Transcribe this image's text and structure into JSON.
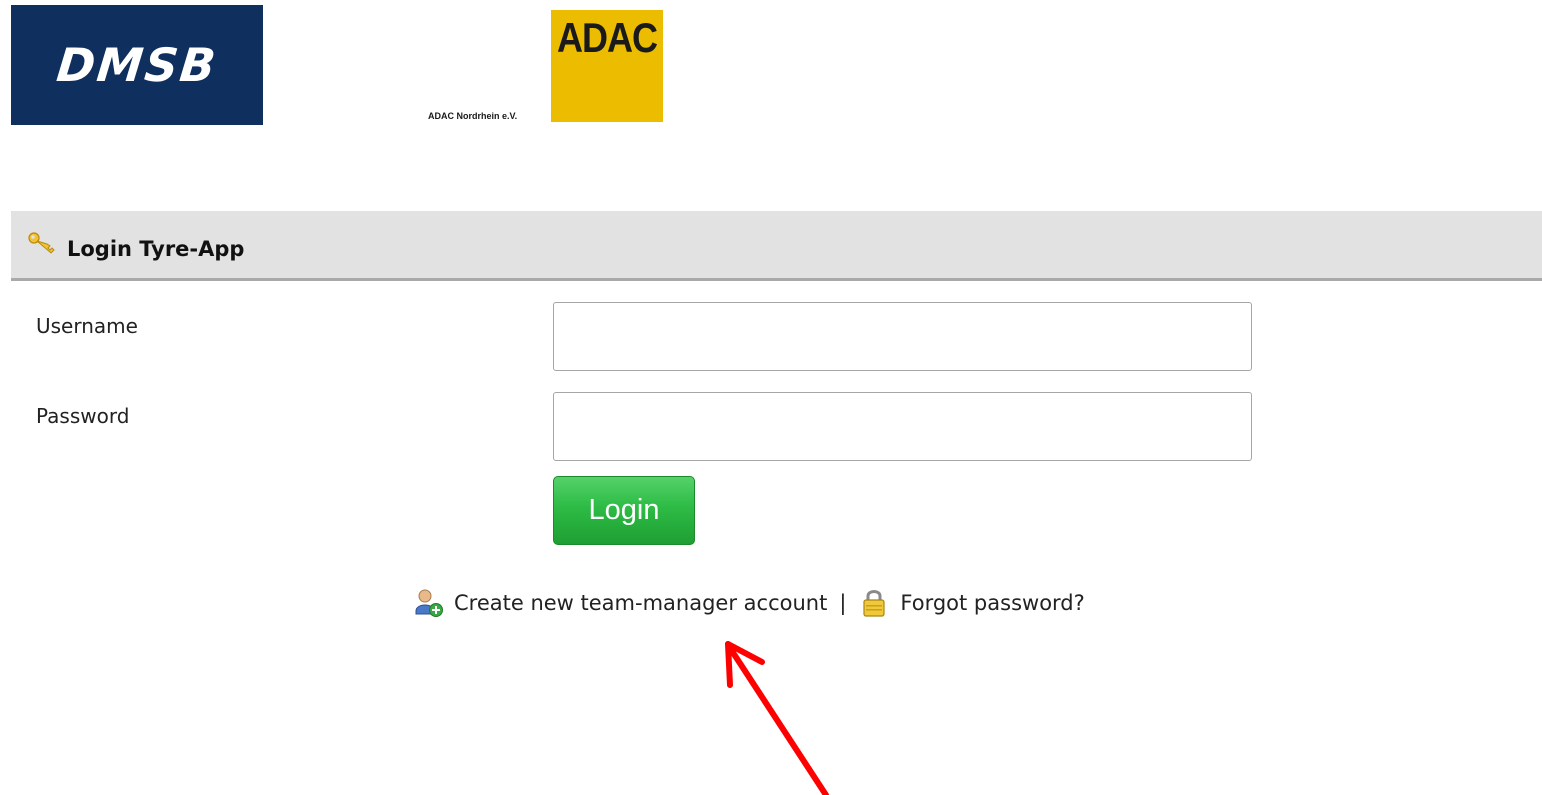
{
  "logos": {
    "dmsb_text": "DMSB",
    "adac_text": "ADAC",
    "adac_subtitle": "ADAC Nordrhein e.V."
  },
  "panel": {
    "title": "Login Tyre-App",
    "icon": "key-icon"
  },
  "form": {
    "username_label": "Username",
    "username_value": "",
    "password_label": "Password",
    "password_value": "",
    "login_button_label": "Login"
  },
  "links": {
    "create_account_label": "Create new team-manager account",
    "create_account_icon": "add-user-icon",
    "separator": "|",
    "forgot_password_label": "Forgot password?",
    "forgot_password_icon": "padlock-icon"
  },
  "colors": {
    "dmsb_blue": "#0f2f5f",
    "adac_yellow": "#ecbc00",
    "header_gray": "#e2e2e2",
    "login_green": "#2dbb45",
    "annotation_red": "#ff0000"
  }
}
